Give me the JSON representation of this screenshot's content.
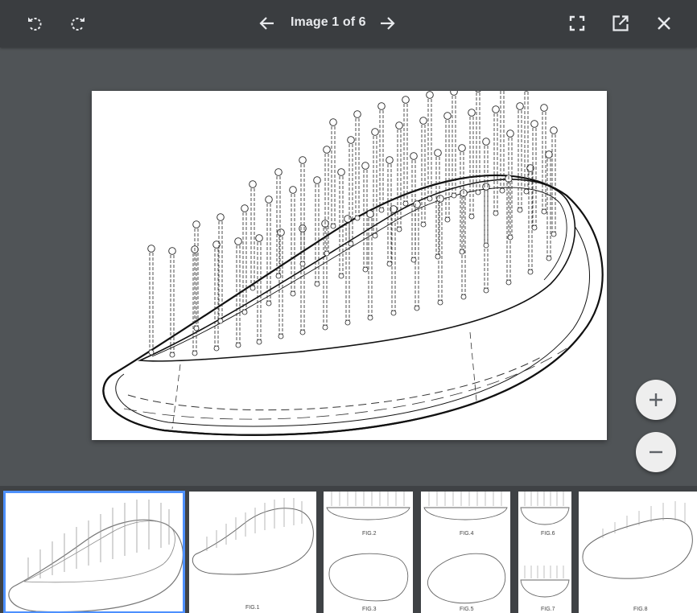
{
  "toolbar": {
    "counter_text": "Image 1 of 6",
    "icons": [
      "rotate-left-icon",
      "rotate-right-icon",
      "arrow-left-icon",
      "arrow-right-icon",
      "fullscreen-icon",
      "open-in-new-icon",
      "close-icon"
    ]
  },
  "zoom": {
    "in_label": "+",
    "out_label": "−"
  },
  "thumbnails": [
    {
      "selected": true,
      "captions": []
    },
    {
      "selected": false,
      "captions": [
        "FIG.1"
      ]
    },
    {
      "selected": false,
      "captions": [
        "FIG.2",
        "FIG.3"
      ]
    },
    {
      "selected": false,
      "captions": [
        "FIG.4",
        "FIG.5"
      ]
    },
    {
      "selected": false,
      "captions": [
        "FIG.6",
        "FIG.7"
      ]
    },
    {
      "selected": false,
      "captions": [
        "FIG.8"
      ]
    }
  ],
  "colors": {
    "toolbar_bg": "#3a3d40",
    "stage_bg": "#505457",
    "strip_bg": "#3f4245",
    "selection": "#4d90fe",
    "icon": "#e8eaed"
  }
}
